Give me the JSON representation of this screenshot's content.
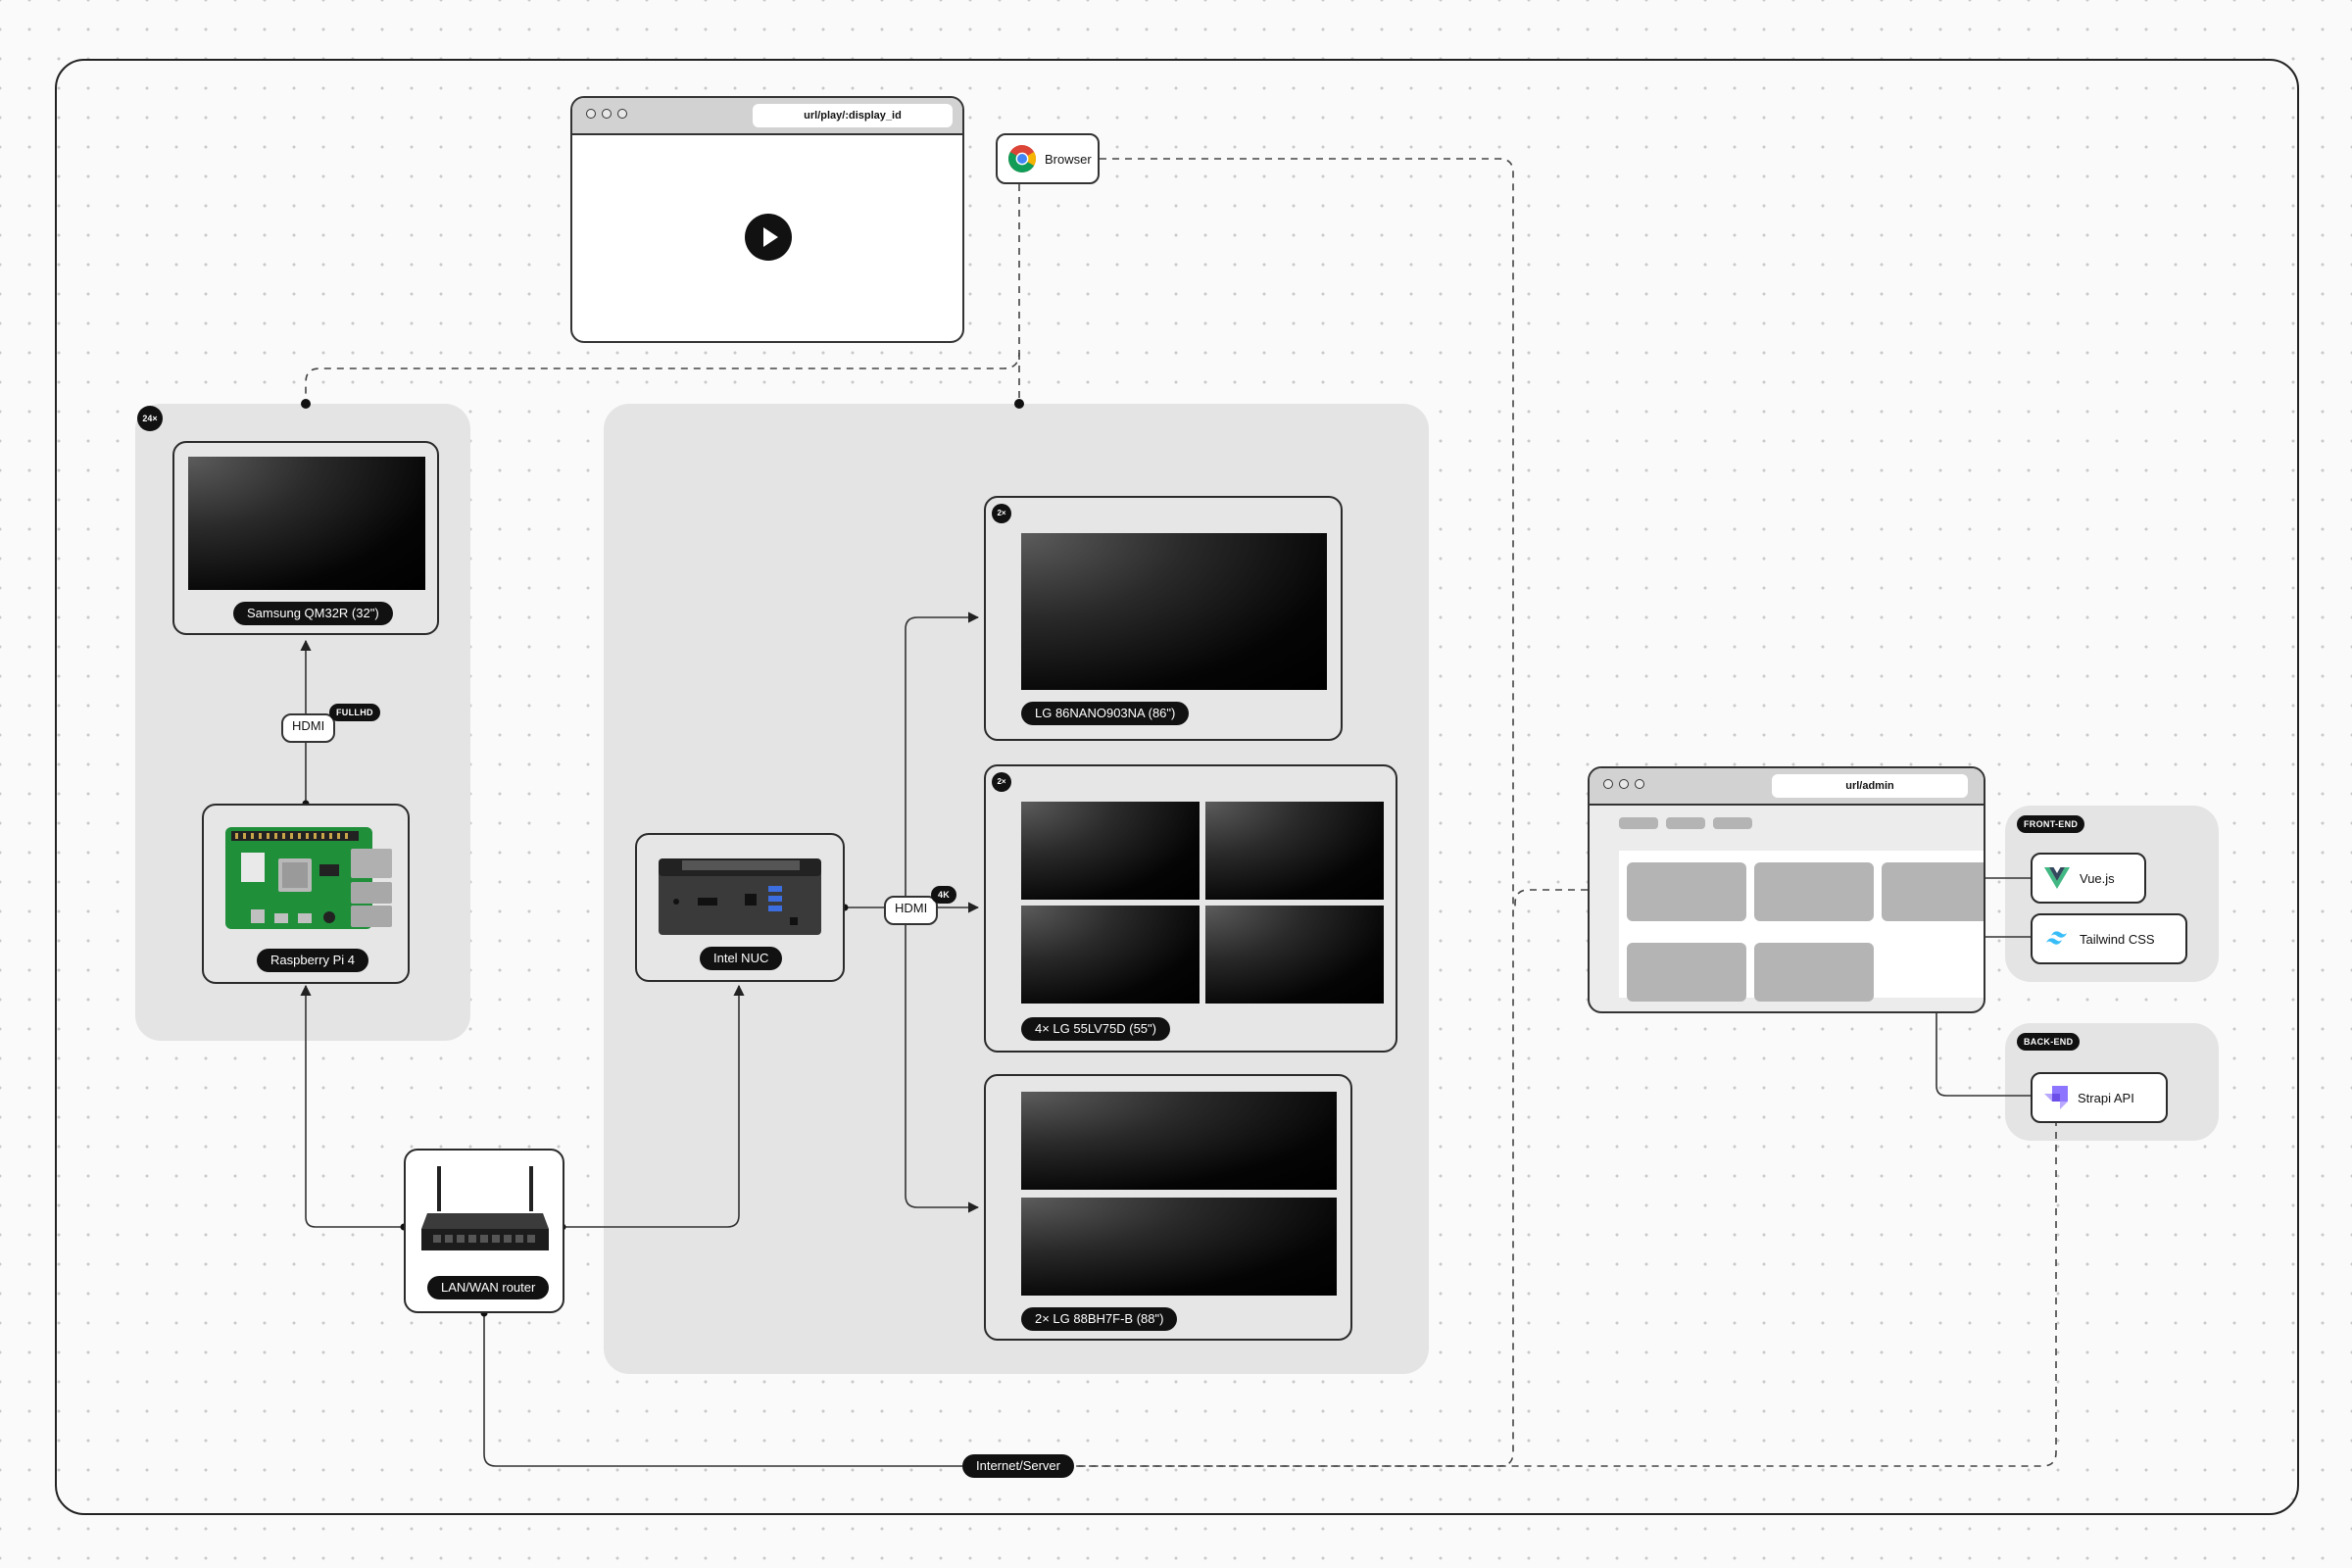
{
  "player_window": {
    "url": "url/play/:display_id"
  },
  "browser": {
    "label": "Browser"
  },
  "raspberry_group": {
    "count_badge": "24×",
    "display_label": "Samsung QM32R (32\")",
    "connection_label": "HDMI",
    "resolution_badge": "FULLHD",
    "device_label": "Raspberry Pi 4"
  },
  "nuc_group": {
    "device_label": "Intel NUC",
    "connection_label": "HDMI",
    "resolution_badge": "4K",
    "displays": [
      {
        "count_badge": "2×",
        "label": "LG 86NANO903NA (86\")"
      },
      {
        "count_badge": "2×",
        "label": "4× LG 55LV75D (55\")"
      },
      {
        "count_badge": "",
        "label": "2× LG 88BH7F-B (88\")"
      }
    ]
  },
  "router": {
    "label": "LAN/WAN router"
  },
  "internet": {
    "label": "Internet/Server"
  },
  "admin_window": {
    "url": "url/admin"
  },
  "frontend": {
    "badge": "FRONT-END",
    "items": [
      {
        "label": "Vue.js",
        "icon": "vue-logo-icon"
      },
      {
        "label": "Tailwind CSS",
        "icon": "tailwind-logo-icon"
      }
    ]
  },
  "backend": {
    "badge": "BACK-END",
    "items": [
      {
        "label": "Strapi API",
        "icon": "strapi-logo-icon"
      }
    ]
  }
}
